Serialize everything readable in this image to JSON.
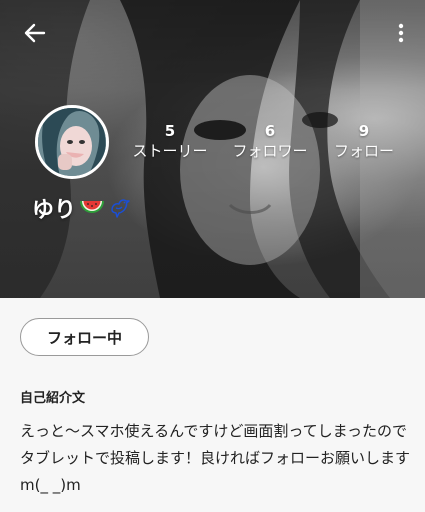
{
  "profile": {
    "username": "ゆり",
    "stats": {
      "stories": {
        "count": "5",
        "label": "ストーリー"
      },
      "followers": {
        "count": "6",
        "label": "フォロワー"
      },
      "following": {
        "count": "9",
        "label": "フォロー"
      }
    },
    "follow_button_label": "フォロー中",
    "bio_title": "自己紹介文",
    "bio_text": "えっと〜スマホ使えるんですけど画面割ってしまったのでタブレットで投稿します！良ければフォローお願いしますm(_ _)m"
  },
  "icons": {
    "back": "arrow-left-icon",
    "menu": "more-vert-icon",
    "emoji_1": "watermelon-emoji",
    "emoji_2": "bird-icon"
  },
  "colors": {
    "accent_bird": "#1a4fd6",
    "text_primary": "#222222",
    "background": "#f7f7f7"
  }
}
